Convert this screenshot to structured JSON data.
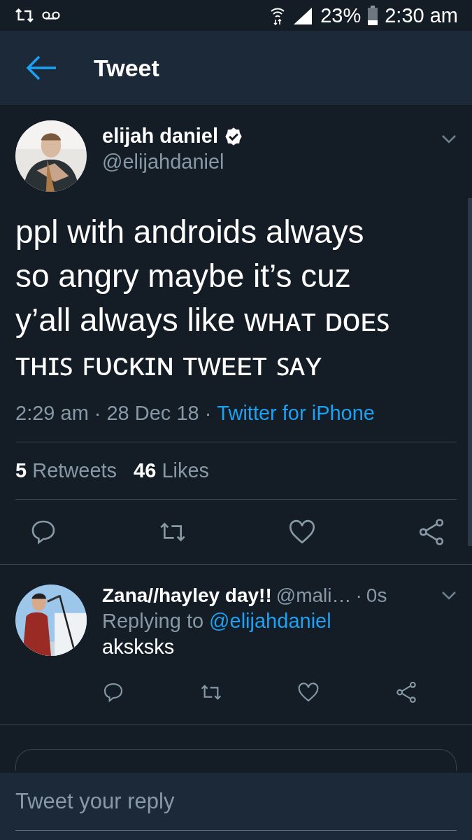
{
  "status_bar": {
    "battery": "23%",
    "time": "2:30 am"
  },
  "header": {
    "title": "Tweet"
  },
  "tweet": {
    "name": "elijah daniel",
    "verified": true,
    "handle": "@elijahdaniel",
    "text": "ppl with androids always so angry maybe it’s cuz y’all always like ᴡʜᴀᴛ ᴅᴏᴇꜱ ᴛʜɪꜱ ꜰᴜᴄᴋɪɴ ᴛᴡᴇᴇᴛ ꜱᴀʏ",
    "time": "2:29 am",
    "separator": "·",
    "date": "28 Dec 18",
    "separator_2": "·",
    "source": "Twitter for iPhone",
    "stats": [
      {
        "count": "5",
        "label": "Retweets"
      },
      {
        "count": "46",
        "label": "Likes"
      }
    ]
  },
  "replies": [
    {
      "name": "Zana//hayley day!!",
      "handle": "@mali…",
      "separator": "·",
      "age": "0s",
      "replying_label": "Replying to",
      "replying_to": "@elijahdaniel",
      "text": "aksksks"
    }
  ],
  "compose": {
    "placeholder": "Tweet your reply"
  }
}
